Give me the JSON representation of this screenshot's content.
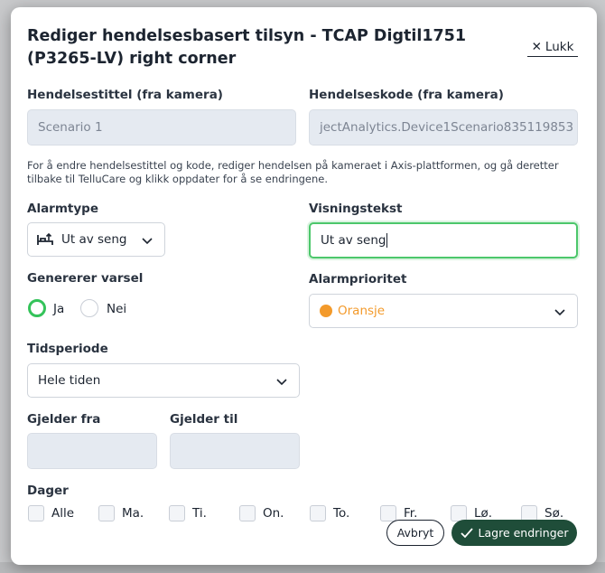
{
  "modal": {
    "title": "Rediger hendelsesbasert tilsyn - TCAP Digtil1751 (P3265-LV) right corner",
    "close_label": "Lukk"
  },
  "event_title": {
    "label": "Hendelsestittel (fra kamera)",
    "value": "Scenario 1"
  },
  "event_code": {
    "label": "Hendelseskode (fra kamera)",
    "value": "jectAnalytics.Device1Scenario835119853"
  },
  "help_text": "For å endre hendelsestittel og kode, rediger hendelsen på kameraet i Axis-plattformen, og gå deretter tilbake til TelluCare og klikk oppdater for å se endringene.",
  "alarm_type": {
    "label": "Alarmtype",
    "value": "Ut av seng",
    "icon": "bed-exit-icon"
  },
  "display_text": {
    "label": "Visningstekst",
    "value": "Ut av seng"
  },
  "generates_alert": {
    "label": "Genererer varsel",
    "options": [
      "Ja",
      "Nei"
    ],
    "selected": "Ja"
  },
  "alarm_priority": {
    "label": "Alarmprioritet",
    "value": "Oransje",
    "color": "#f39a2b"
  },
  "time_period": {
    "label": "Tidsperiode",
    "value": "Hele tiden"
  },
  "valid_from": {
    "label": "Gjelder fra",
    "value": ""
  },
  "valid_to": {
    "label": "Gjelder til",
    "value": ""
  },
  "days": {
    "label": "Dager",
    "options": [
      "Alle",
      "Ma.",
      "Ti.",
      "On.",
      "To.",
      "Fr.",
      "Lø.",
      "Sø."
    ]
  },
  "footer": {
    "cancel_label": "Avbryt",
    "save_label": "Lagre endringer"
  },
  "colors": {
    "focus_green": "#4cc76b",
    "save_button": "#1f4d39",
    "radio_checked": "#34c35a"
  }
}
